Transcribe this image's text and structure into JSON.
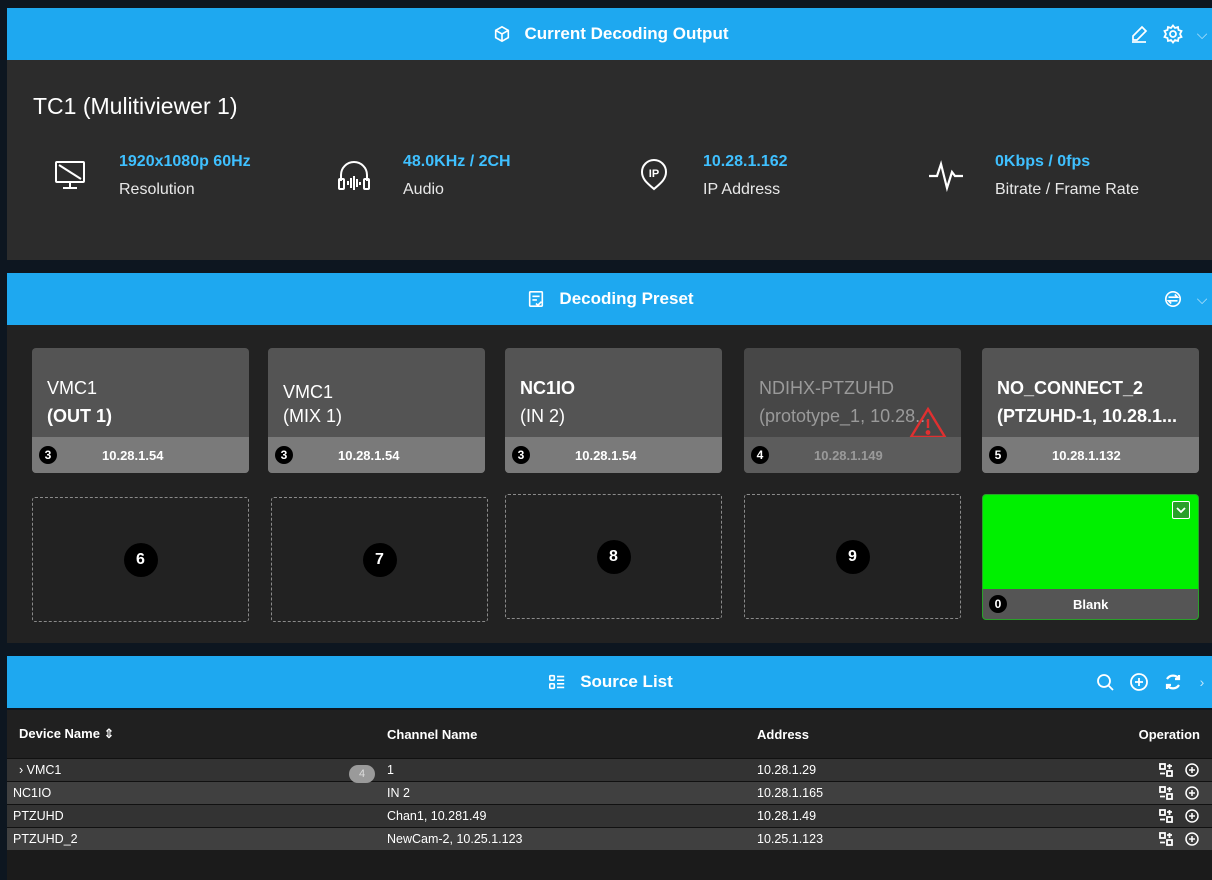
{
  "output_panel": {
    "title": "Current Decoding Output",
    "device_name": "TC1 (Mulitiviewer 1)",
    "stats": [
      {
        "icon": "monitor-icon",
        "value": "1920x1080p 60Hz",
        "label": "Resolution"
      },
      {
        "icon": "headphones-icon",
        "value": "48.0KHz / 2CH",
        "label": "Audio"
      },
      {
        "icon": "ip-icon",
        "value": "10.28.1.162",
        "label": "IP Address"
      },
      {
        "icon": "pulse-icon",
        "value": "0Kbps / 0fps",
        "label": "Bitrate / Frame Rate"
      }
    ]
  },
  "preset_panel": {
    "title": "Decoding Preset",
    "tiles": [
      {
        "line1": "VMC1",
        "line2": "(OUT 1)",
        "num": "3",
        "address": "10.28.1.54"
      },
      {
        "line1": "VMC1",
        "line2": "(MIX 1)",
        "num": "3",
        "address": "10.28.1.54"
      },
      {
        "line1": "NC1IO",
        "line2": "(IN 2)",
        "num": "3",
        "address": "10.28.1.54"
      },
      {
        "line1": "NDIHX-PTZUHD",
        "line2": "(prototype_1, 10.28...",
        "num": "4",
        "address": "10.28.1.149"
      },
      {
        "line1": "NO_CONNECT_2",
        "line2": "(PTZUHD-1, 10.28.1...",
        "num": "5",
        "address": "10.28.1.132"
      }
    ],
    "empty_slots": [
      "6",
      "7",
      "8",
      "9"
    ],
    "blank_tile": {
      "num": "0",
      "label": "Blank",
      "color": "#00f000"
    }
  },
  "source_panel": {
    "title": "Source List",
    "columns": [
      "Device Name ⇕",
      "Channel Name",
      "Address",
      "Operation"
    ],
    "rows": [
      {
        "device": "› VMC1",
        "badge": "4",
        "channel": "1",
        "address": "10.28.1.29"
      },
      {
        "device": "NC1IO",
        "channel": "IN 2",
        "address": "10.28.1.165"
      },
      {
        "device": "PTZUHD",
        "channel": "Chan1, 10.281.49",
        "address": "10.28.1.49"
      },
      {
        "device": "PTZUHD_2",
        "channel": "NewCam-2, 10.25.1.123",
        "address": "10.25.1.123"
      }
    ]
  },
  "colors": {
    "accent": "#1ea8f0",
    "value_text": "#3fc0ff",
    "warning": "#e03030",
    "blank_green": "#00f000"
  }
}
